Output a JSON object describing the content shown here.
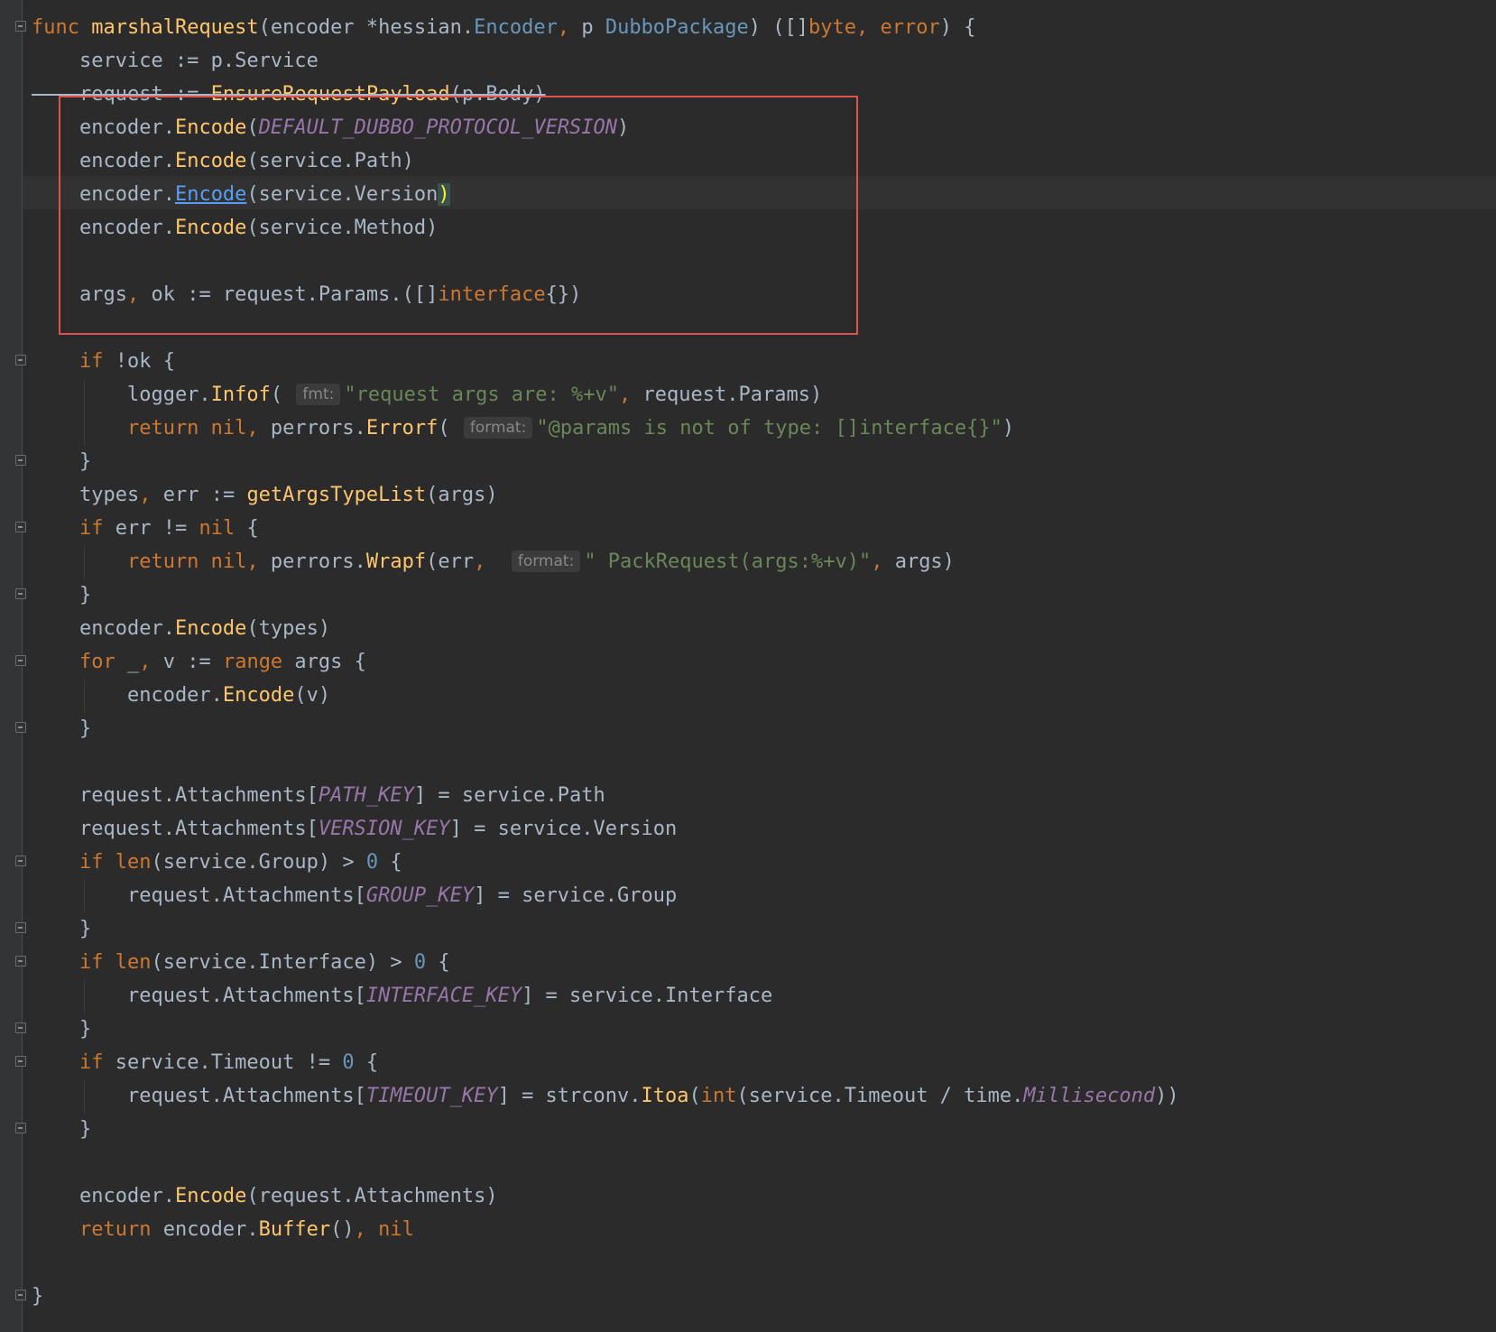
{
  "editor": {
    "highlight_color": "#e0524c",
    "theme_background": "#2b2b2b",
    "code": {
      "func_kw": "func",
      "func_name": "marshalRequest",
      "sig_open": "(encoder ",
      "sig_ptr": "*hessian.",
      "sig_encoder_type": "Encoder",
      "sig_comma1": ",",
      "sig_p": " p ",
      "sig_pkg_type": "DubboPackage",
      "sig_close": ") ([]",
      "ret_byte": "byte",
      "ret_comma": ",",
      "ret_error": " error",
      "sig_end": ") {",
      "l2": "    service := p.Service",
      "l3_a": "    request := ",
      "l3_fn": "EnsureRequestPayload",
      "l3_b": "(p.Body)",
      "enc_prefix": "    encoder.",
      "enc_method": "Encode",
      "enc4_open": "(",
      "enc4_const": "DEFAULT_DUBBO_PROTOCOL_VERSION",
      "enc4_close": ")",
      "enc5_args": "(service.Path)",
      "enc6_args_a": "(service.Version",
      "enc6_args_b": ")",
      "enc7_args": "(service.Method)",
      "l9_a": "    args",
      "l9_comma": ",",
      "l9_b": " ok := request.Params.([]",
      "l9_iface": "interface",
      "l9_c": "{})",
      "l11_kw": "    if",
      "l11_rest": " !ok {",
      "l12_a": "        logger.",
      "l12_fn": "Infof",
      "l12_open": "( ",
      "hint_fmt": "fmt:",
      "l12_str": "\"request args are: %+v\"",
      "l12_comma": ",",
      "l12_rest": " request.Params)",
      "l13_ret": "        return",
      "l13_nil": " nil",
      "l13_comma": ",",
      "l13_a": " perrors.",
      "l13_fn": "Errorf",
      "l13_open": "( ",
      "hint_format": "format:",
      "l13_str": "\"@params is not of type: []interface{}\"",
      "l13_close": ")",
      "close_brace_4": "    }",
      "l15_a": "    types",
      "l15_comma": ",",
      "l15_b": " err := ",
      "l15_fn": "getArgsTypeList",
      "l15_c": "(args)",
      "l16_kw": "    if",
      "l16_a": " err != ",
      "l16_nil": "nil",
      "l16_b": " {",
      "l17_ret": "        return",
      "l17_nil": " nil",
      "l17_comma": ",",
      "l17_a": " perrors.",
      "l17_fn": "Wrapf",
      "l17_b": "(err",
      "l17_comma2": ",",
      "l17_sp": "  ",
      "l17_str": "\" PackRequest(args:%+v)\"",
      "l17_comma3": ",",
      "l17_c": " args)",
      "l19_args": "(types)",
      "l20_kw": "    for",
      "l20_a": " _",
      "l20_comma": ",",
      "l20_b": " v := ",
      "l20_range": "range",
      "l20_c": " args {",
      "l21_a": "        encoder.",
      "l21_b": "(v)",
      "att_prefix": "    request.Attachments[",
      "att_prefix_in": "        request.Attachments[",
      "path_key": "PATH_KEY",
      "att_path_rest": "] = service.Path",
      "version_key": "VERSION_KEY",
      "att_version_rest": "] = service.Version",
      "if_kw": "    if",
      "len_fn": " len",
      "l26_a": "(service.Group) > ",
      "zero": "0",
      "brace_open": " {",
      "group_key": "GROUP_KEY",
      "att_group_rest": "] = service.Group",
      "l29_a": "(service.Interface) > ",
      "interface_key": "INTERFACE_KEY",
      "att_iface_rest": "] = service.Interface",
      "l32_a": " service.Timeout != ",
      "timeout_key": "TIMEOUT_KEY",
      "l33_a": "] = strconv.",
      "l33_fn": "Itoa",
      "l33_open": "(",
      "l33_int": "int",
      "l33_b": "(service.Timeout / time.",
      "l33_const": "Millisecond",
      "l33_close": "))",
      "l36_args": "(request.Attachments)",
      "l37_ret": "    return",
      "l37_a": " encoder.",
      "l37_fn": "Buffer",
      "l37_b": "()",
      "l37_comma": ",",
      "l37_nil": " nil",
      "final_brace": "}"
    }
  }
}
